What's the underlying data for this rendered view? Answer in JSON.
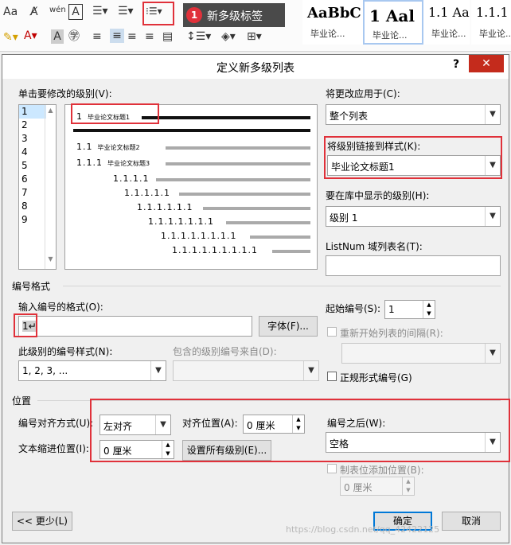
{
  "ribbon": {
    "tooltip_badge": "1",
    "tooltip_text": "新多级标签",
    "style_samples": [
      {
        "sample": "AaBbC",
        "label": "毕业论..."
      },
      {
        "sample": "1 Aal",
        "label": "毕业论..."
      },
      {
        "sample": "1.1 Aa",
        "label": "毕业论..."
      },
      {
        "sample": "1.1.1",
        "label": "毕业论..."
      }
    ]
  },
  "dialog": {
    "title": "定义新多级列表",
    "help": "?",
    "close": "✕",
    "level_label": "单击要修改的级别(V):",
    "levels": [
      "1",
      "2",
      "3",
      "4",
      "5",
      "6",
      "7",
      "8",
      "9"
    ],
    "selected_level": "1",
    "preview": [
      {
        "num": "1",
        "text": "毕业论文标题1"
      },
      {
        "num": "1.1",
        "text": "毕业论文标题2"
      },
      {
        "num": "1.1.1",
        "text": "毕业论文标题3"
      },
      {
        "num": "1.1.1.1",
        "text": ""
      },
      {
        "num": "1.1.1.1.1",
        "text": ""
      },
      {
        "num": "1.1.1.1.1.1",
        "text": ""
      },
      {
        "num": "1.1.1.1.1.1.1",
        "text": ""
      },
      {
        "num": "1.1.1.1.1.1.1.1",
        "text": ""
      },
      {
        "num": "1.1.1.1.1.1.1.1.1",
        "text": ""
      }
    ],
    "apply_to_label": "将更改应用于(C):",
    "apply_to_value": "整个列表",
    "link_style_label": "将级别链接到样式(K):",
    "link_style_value": "毕业论文标题1",
    "gallery_level_label": "要在库中显示的级别(H):",
    "gallery_level_value": "级别 1",
    "listnum_label": "ListNum 域列表名(T):",
    "listnum_value": "",
    "number_format_section": "编号格式",
    "enter_format_label": "输入编号的格式(O):",
    "enter_format_value": "1↵",
    "font_button": "字体(F)...",
    "start_at_label": "起始编号(S):",
    "start_at_value": "1",
    "restart_label": "重新开始列表的间隔(R):",
    "number_style_label": "此级别的编号样式(N):",
    "number_style_value": "1, 2, 3, ...",
    "include_from_label": "包含的级别编号来自(D):",
    "legal_label": "正规形式编号(G)",
    "position_section": "位置",
    "alignment_label": "编号对齐方式(U):",
    "alignment_value": "左对齐",
    "aligned_at_label": "对齐位置(A):",
    "aligned_at_value": "0 厘米",
    "follow_label": "编号之后(W):",
    "follow_value": "空格",
    "indent_label": "文本缩进位置(I):",
    "indent_value": "0 厘米",
    "set_all_button": "设置所有级别(E)...",
    "tab_stop_label": "制表位添加位置(B):",
    "tab_stop_value": "0 厘米",
    "less_button": "<< 更少(L)",
    "ok_button": "确定",
    "cancel_button": "取消"
  },
  "watermark": "https://blog.csdn.net/qq_42422125",
  "colors": {
    "highlight": "#e0313a",
    "selection": "#cce8ff",
    "accent": "#0078d7"
  }
}
